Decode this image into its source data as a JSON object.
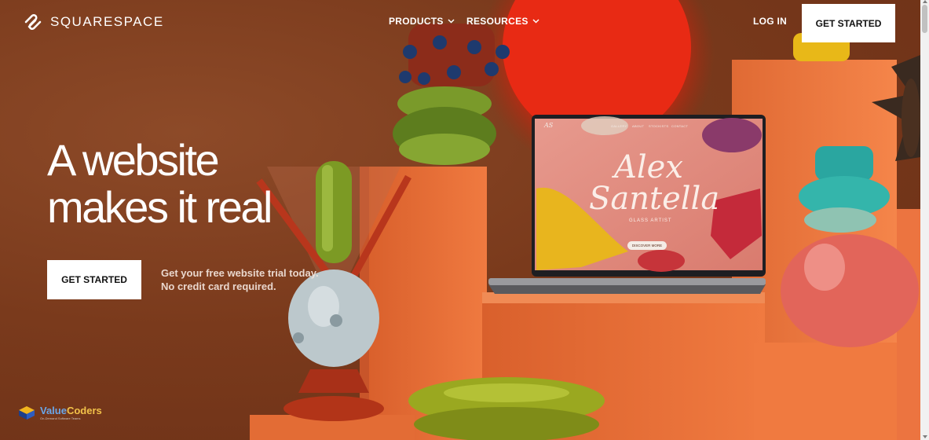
{
  "nav": {
    "brand": "SQUARESPACE",
    "products": "PRODUCTS",
    "resources": "RESOURCES",
    "login": "LOG IN",
    "cta": "GET STARTED"
  },
  "hero": {
    "headline": "A website\nmakes it real",
    "cta": "GET STARTED",
    "subtext_line1": "Get your free website trial today.",
    "subtext_line2": "No credit card required."
  },
  "laptop_site": {
    "logo": "AS",
    "nav_items": [
      "GALLERY",
      "ABOUT",
      "STOCKISTS",
      "CONTACT"
    ],
    "title_line1": "Alex",
    "title_line2": "Santella",
    "subtitle": "GLASS ARTIST",
    "button": "DISCOVER MORE"
  },
  "watermark": {
    "name_a": "Value",
    "name_b": "Coders",
    "tagline": "On-Demand Software Teams"
  },
  "colors": {
    "background": "#7a3a1c",
    "pedestal": "#e8703a",
    "accent_red": "#e8261a",
    "cta_bg": "#ffffff"
  },
  "icons": [
    "squarespace-logo-icon",
    "chevron-down-icon",
    "valuecoders-logo-icon"
  ]
}
